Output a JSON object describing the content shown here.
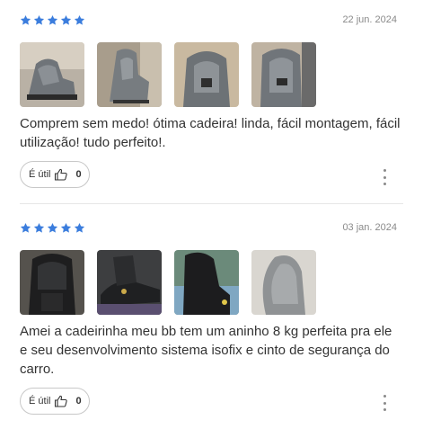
{
  "accent_color": "#3b7ddd",
  "reviews": [
    {
      "rating": 5,
      "date": "22 jun. 2024",
      "photos": [
        "car-seat-photo",
        "car-seat-photo",
        "car-seat-photo",
        "car-seat-photo"
      ],
      "text": "Comprem sem medo! ótima cadeira! linda, fácil montagem, fácil utilização! tudo perfeito!.",
      "helpful_label": "É útil",
      "helpful_count": "0"
    },
    {
      "rating": 5,
      "date": "03 jan. 2024",
      "photos": [
        "car-seat-photo",
        "car-seat-photo",
        "car-seat-photo",
        "car-seat-photo"
      ],
      "text": "Amei a cadeirinha meu bb tem um aninho 8 kg perfeita pra ele e seu desenvolvimento sistema isofix e cinto de segurança do carro.",
      "helpful_label": "É útil",
      "helpful_count": "0"
    }
  ]
}
